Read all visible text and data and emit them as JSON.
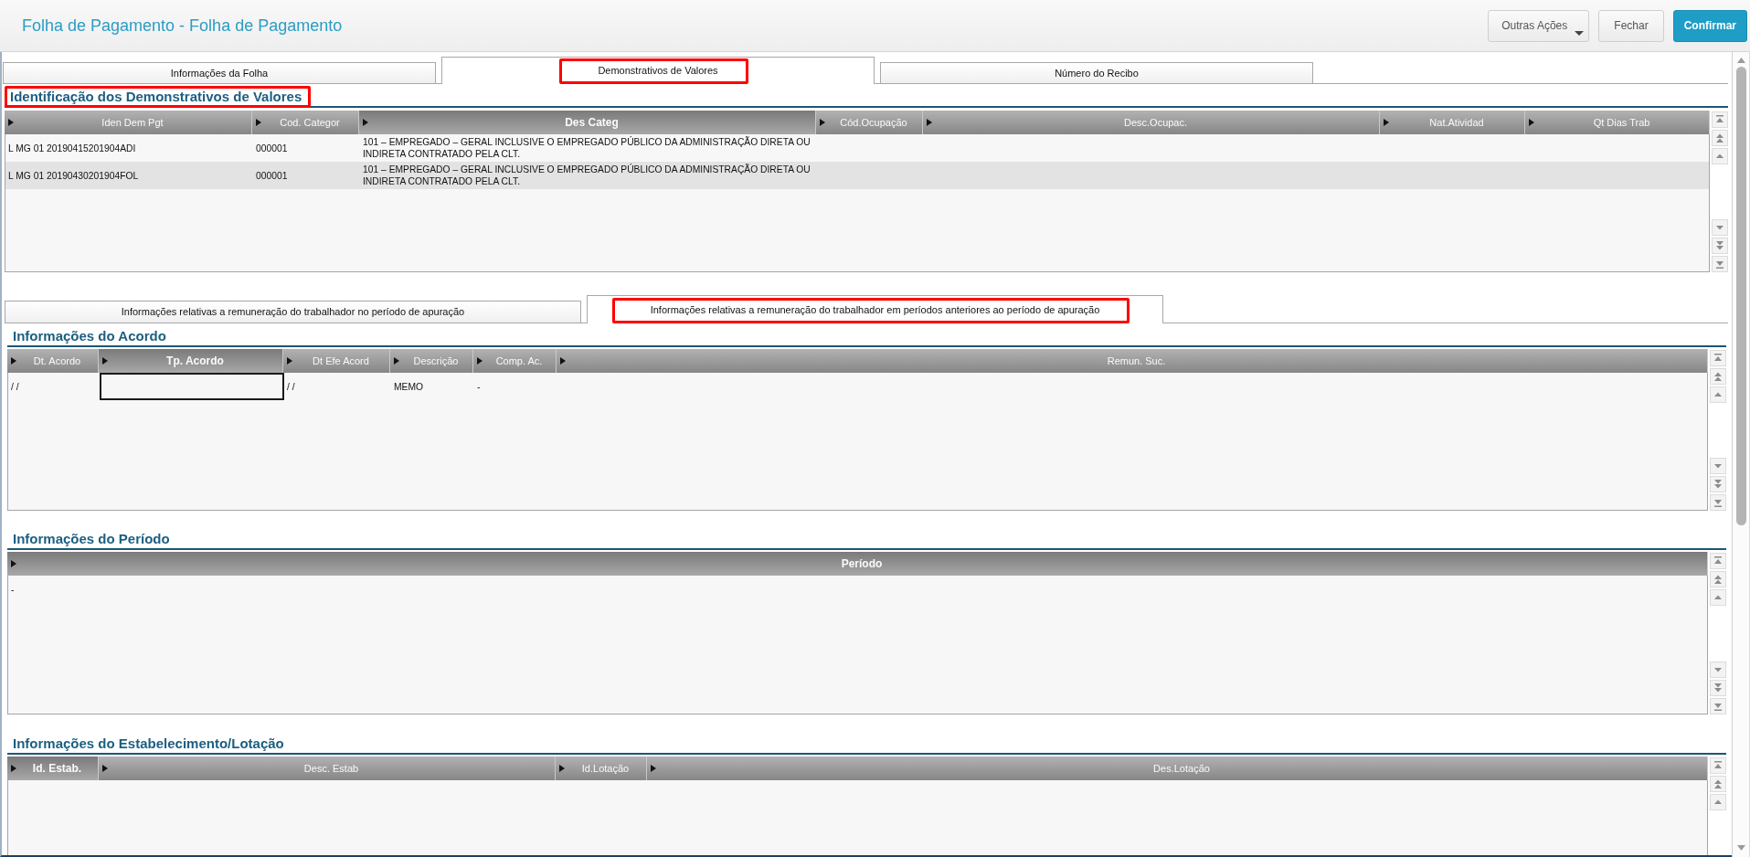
{
  "window": {
    "title": "Folha de Pagamento - Folha de Pagamento"
  },
  "actions": [
    {
      "label": "Outras Ações",
      "kind": "menu"
    },
    {
      "label": "Fechar",
      "kind": "secondary"
    },
    {
      "label": "Confirmar",
      "kind": "primary"
    }
  ],
  "tabs": [
    {
      "label": "Informações da Folha",
      "selected": false,
      "highlighted": false
    },
    {
      "label": "Demonstrativos de Valores",
      "selected": true,
      "highlighted": true
    },
    {
      "label": "Número do Recibo",
      "selected": false,
      "highlighted": false
    }
  ],
  "section": {
    "title": "Identificação dos Demonstrativos de Valores",
    "highlighted": true,
    "table": {
      "columns": [
        {
          "label": "Iden Dem Pgt",
          "selected": false
        },
        {
          "label": "Cod. Categor",
          "selected": false
        },
        {
          "label": "Des Categ",
          "selected": true
        },
        {
          "label": "Cód.Ocupação",
          "selected": false
        },
        {
          "label": "Desc.Ocupac.",
          "selected": false
        },
        {
          "label": "Nat.Atividad",
          "selected": false
        },
        {
          "label": "Qt Dias Trab",
          "selected": false
        }
      ],
      "rows": [
        {
          "cells": [
            {
              "text": "L MG 01 20190415201904ADI",
              "focused": false
            },
            {
              "text": "000001",
              "focused": false
            },
            {
              "text": "101 – EMPREGADO – GERAL INCLUSIVE O EMPREGADO PÚBLICO DA ADMINISTRAÇÃO DIRETA OU INDIRETA CONTRATADO PELA CLT.",
              "focused": false
            }
          ]
        },
        {
          "cells": [
            {
              "text": "L MG 01 20190430201904FOL",
              "focused": false
            },
            {
              "text": "000001",
              "focused": false
            },
            {
              "text": "101 – EMPREGADO – GERAL INCLUSIVE O EMPREGADO PÚBLICO DA ADMINISTRAÇÃO DIRETA OU INDIRETA CONTRATADO PELA CLT.",
              "focused": false
            }
          ]
        }
      ]
    }
  },
  "sub_tabs": [
    {
      "label": "Informações relativas a remuneração do trabalhador no período de apuração",
      "selected": false,
      "highlighted": false
    },
    {
      "label": "Informações relativas a remuneração do trabalhador em períodos anteriores ao período de apuração",
      "selected": true,
      "highlighted": true
    }
  ],
  "sub_sections": [
    {
      "title": "Informações do Acordo",
      "highlighted": false,
      "table": {
        "columns": [
          {
            "label": "Dt. Acordo",
            "selected": false
          },
          {
            "label": "Tp. Acordo",
            "selected": true
          },
          {
            "label": "Dt Efe Acord",
            "selected": false
          },
          {
            "label": "Descrição",
            "selected": false
          },
          {
            "label": "Comp. Ac.",
            "selected": false
          },
          {
            "label": "Remun. Suc.",
            "selected": false
          }
        ],
        "rows": [
          {
            "cells": [
              {
                "text": "/ /",
                "focused": false
              },
              {
                "focused": true
              },
              {
                "text": "/ /",
                "focused": false
              },
              {
                "text": "MEMO",
                "focused": false
              },
              {
                "text": "-",
                "focused": false
              }
            ]
          }
        ]
      }
    },
    {
      "title": "Informações do Período",
      "highlighted": false,
      "table": {
        "columns": [
          {
            "label": "Período",
            "selected": true
          }
        ],
        "rows": [
          {
            "cells": [
              {
                "text": "-",
                "focused": false
              }
            ]
          }
        ]
      }
    },
    {
      "title": "Informações do Estabelecimento/Lotação",
      "highlighted": false,
      "table": {
        "columns": [
          {
            "label": "Id. Estab.",
            "selected": true
          },
          {
            "label": "Desc. Estab",
            "selected": false
          },
          {
            "label": "Id.Lotação",
            "selected": false
          },
          {
            "label": "Des.Lotação",
            "selected": false
          }
        ]
      }
    }
  ]
}
